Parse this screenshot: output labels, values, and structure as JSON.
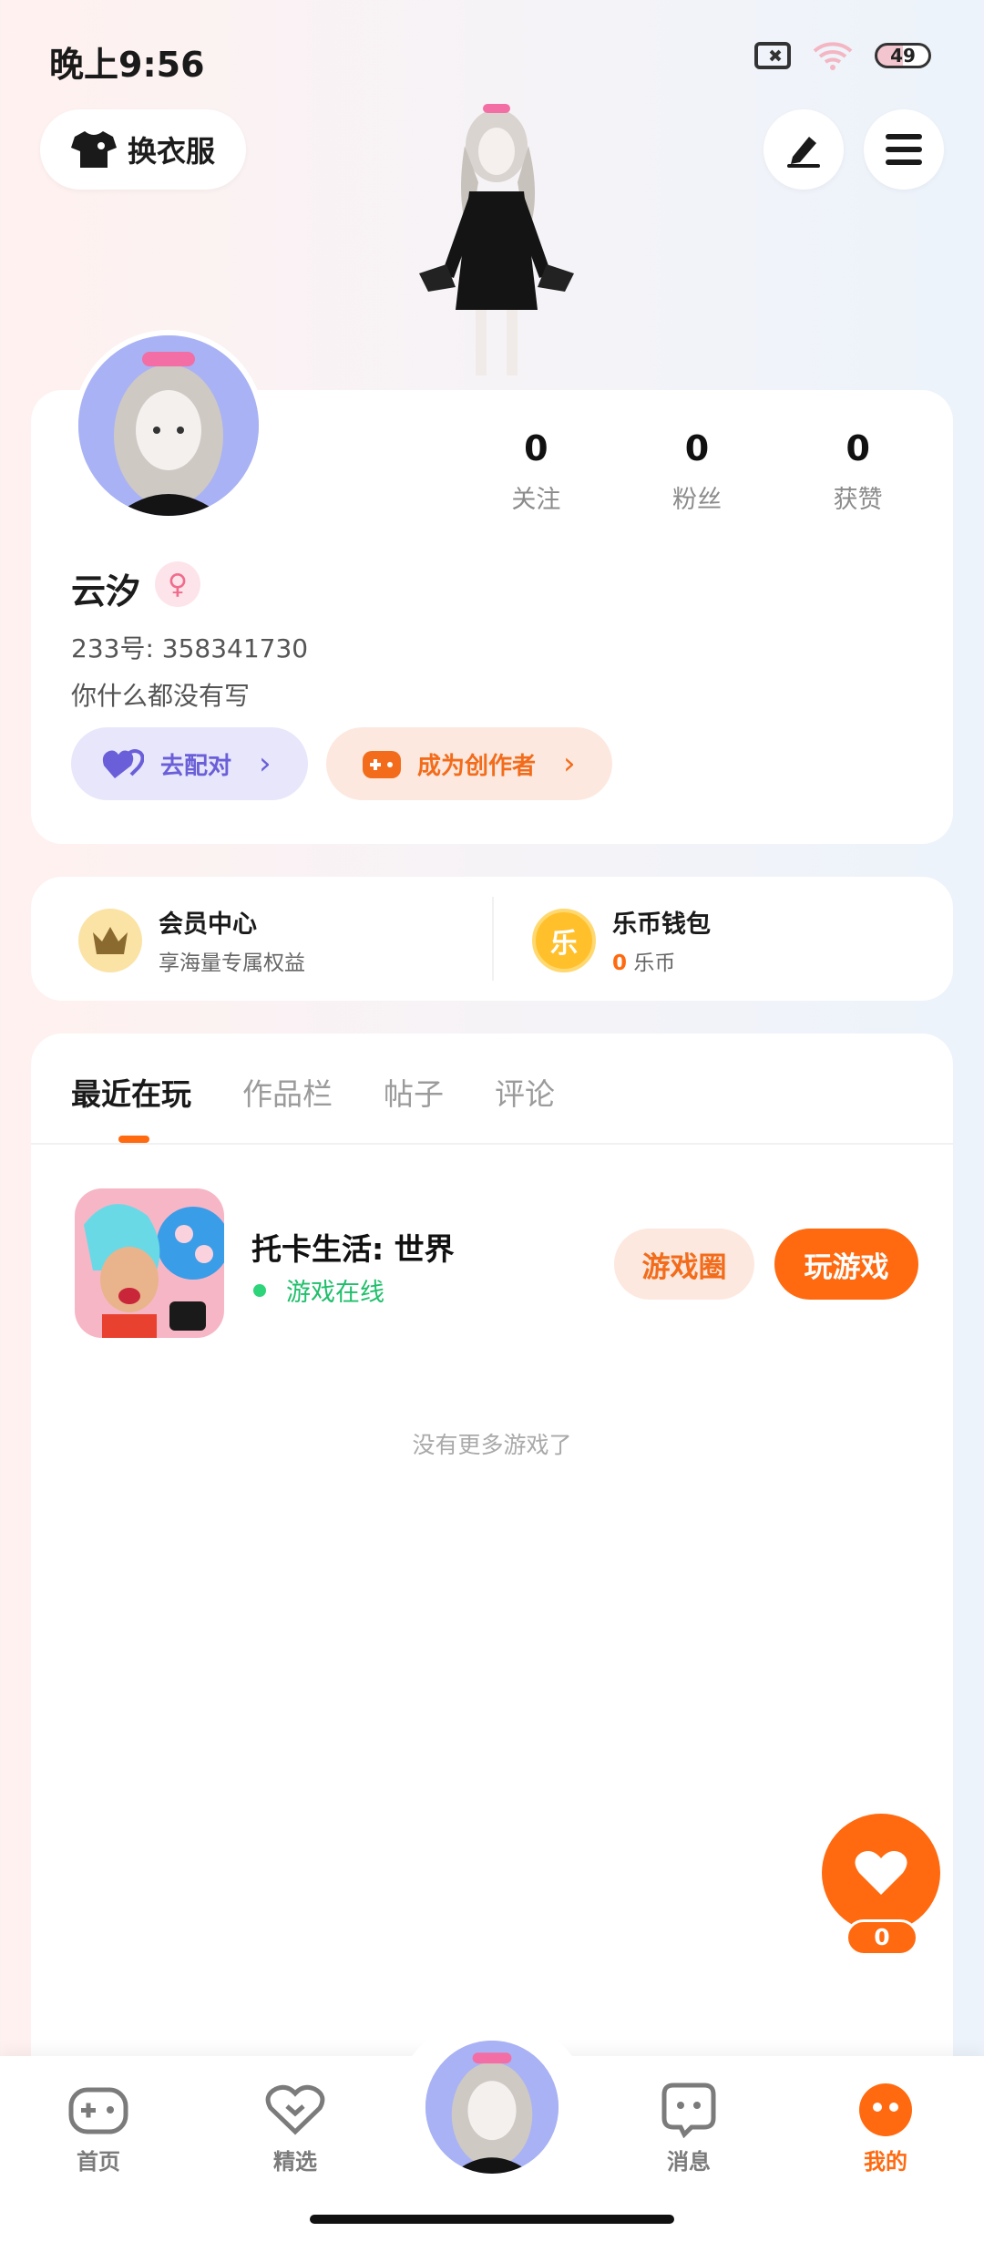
{
  "status_bar": {
    "time": "晚上9:56",
    "battery": "49"
  },
  "header": {
    "outfit_label": "换衣服"
  },
  "profile": {
    "stats": [
      {
        "value": "0",
        "label": "关注"
      },
      {
        "value": "0",
        "label": "粉丝"
      },
      {
        "value": "0",
        "label": "获赞"
      }
    ],
    "name": "云汐",
    "gender_symbol": "♀",
    "uid": "233号: 358341730",
    "bio": "你什么都没有写",
    "match_label": "去配对",
    "creator_label": "成为创作者"
  },
  "quick": {
    "vip_title": "会员中心",
    "vip_sub": "享海量专属权益",
    "coin_icon_text": "乐",
    "wallet_title": "乐币钱包",
    "wallet_amount": "0",
    "wallet_unit": "乐币"
  },
  "tabs": [
    "最近在玩",
    "作品栏",
    "帖子",
    "评论"
  ],
  "recent_game": {
    "title": "托卡生活: 世界",
    "status": "游戏在线",
    "circle_label": "游戏圈",
    "play_label": "玩游戏"
  },
  "empty_text": "没有更多游戏了",
  "like_count": "0",
  "bottom_nav": [
    {
      "label": "首页",
      "icon": "gamepad-icon"
    },
    {
      "label": "精选",
      "icon": "featured-heart-icon"
    },
    {
      "label": "",
      "icon": "avatar"
    },
    {
      "label": "消息",
      "icon": "message-icon"
    },
    {
      "label": "我的",
      "icon": "profile-face-icon"
    }
  ],
  "colors": {
    "accent": "#ff6a10",
    "purple": "#6a5fd8",
    "online": "#1fbf6b"
  }
}
